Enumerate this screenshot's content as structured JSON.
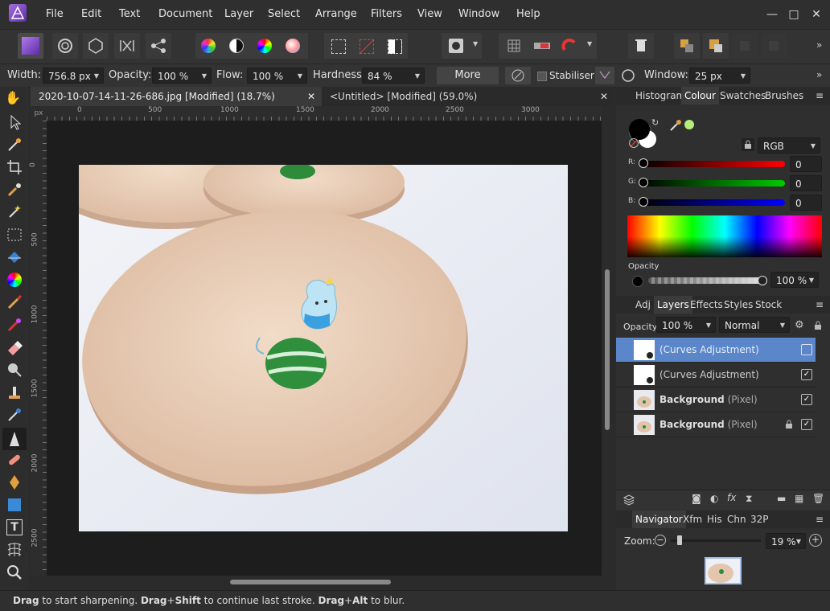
{
  "menu": [
    "File",
    "Edit",
    "Text",
    "Document",
    "Layer",
    "Select",
    "Arrange",
    "Filters",
    "View",
    "Window",
    "Help"
  ],
  "window_controls": {
    "minimize": "—",
    "maximize": "□",
    "close": "✕"
  },
  "context": {
    "width_label": "Width:",
    "width_value": "756.8 px",
    "opacity_label": "Opacity:",
    "opacity_value": "100 %",
    "flow_label": "Flow:",
    "flow_value": "100 %",
    "hardness_label": "Hardness:",
    "hardness_value": "84 %",
    "more_label": "More",
    "stabiliser_label": "Stabiliser",
    "window_label": "Window:",
    "window_value": "25 px"
  },
  "tabs": [
    {
      "label": "2020-10-07-14-11-26-686.jpg [Modified] (18.7%)",
      "close": "✕"
    },
    {
      "label": "<Untitled> [Modified] (59.0%)",
      "close": "✕"
    }
  ],
  "ruler": {
    "unit": "px",
    "top": [
      "0",
      "500",
      "1000",
      "1500",
      "2000",
      "2500",
      "3000"
    ],
    "left": [
      "0",
      "500",
      "1000",
      "1500",
      "2000",
      "2500"
    ]
  },
  "colour_panel": {
    "tabs": [
      "Histogram",
      "Colour",
      "Swatches",
      "Brushes"
    ],
    "active": "Colour",
    "model": "RGB",
    "r_label": "R:",
    "r_value": "0",
    "g_label": "G:",
    "g_value": "0",
    "b_label": "B:",
    "b_value": "0",
    "opacity_label": "Opacity",
    "opacity_value": "100 %"
  },
  "layers_panel": {
    "tabs": [
      "Adj",
      "Layers",
      "Effects",
      "Styles",
      "Stock"
    ],
    "active": "Layers",
    "opacity_label": "Opacity:",
    "opacity_value": "100 %",
    "blend": "Normal",
    "layers": [
      {
        "name": "(Curves Adjustment)",
        "kind": "",
        "selected": true,
        "checked": false,
        "locked": false
      },
      {
        "name": "(Curves Adjustment)",
        "kind": "",
        "selected": false,
        "checked": true,
        "locked": false
      },
      {
        "name": "Background",
        "kind": "(Pixel)",
        "selected": false,
        "checked": true,
        "locked": false
      },
      {
        "name": "Background",
        "kind": "(Pixel)",
        "selected": false,
        "checked": true,
        "locked": true
      }
    ]
  },
  "navigator_panel": {
    "tabs": [
      "Navigator",
      "Xfm",
      "His",
      "Chn",
      "32P"
    ],
    "active": "Navigator",
    "zoom_label": "Zoom:",
    "zoom_value": "19 %"
  },
  "status": {
    "b1": "Drag",
    "t1": " to start sharpening. ",
    "b2": "Drag",
    "t2": "+",
    "b3": "Shift",
    "t3": " to continue last stroke. ",
    "b4": "Drag",
    "t4": "+",
    "b5": "Alt",
    "t5": " to blur."
  },
  "colors": {
    "accent": "#5f8fd4",
    "selected_row": "#5b86c9"
  }
}
